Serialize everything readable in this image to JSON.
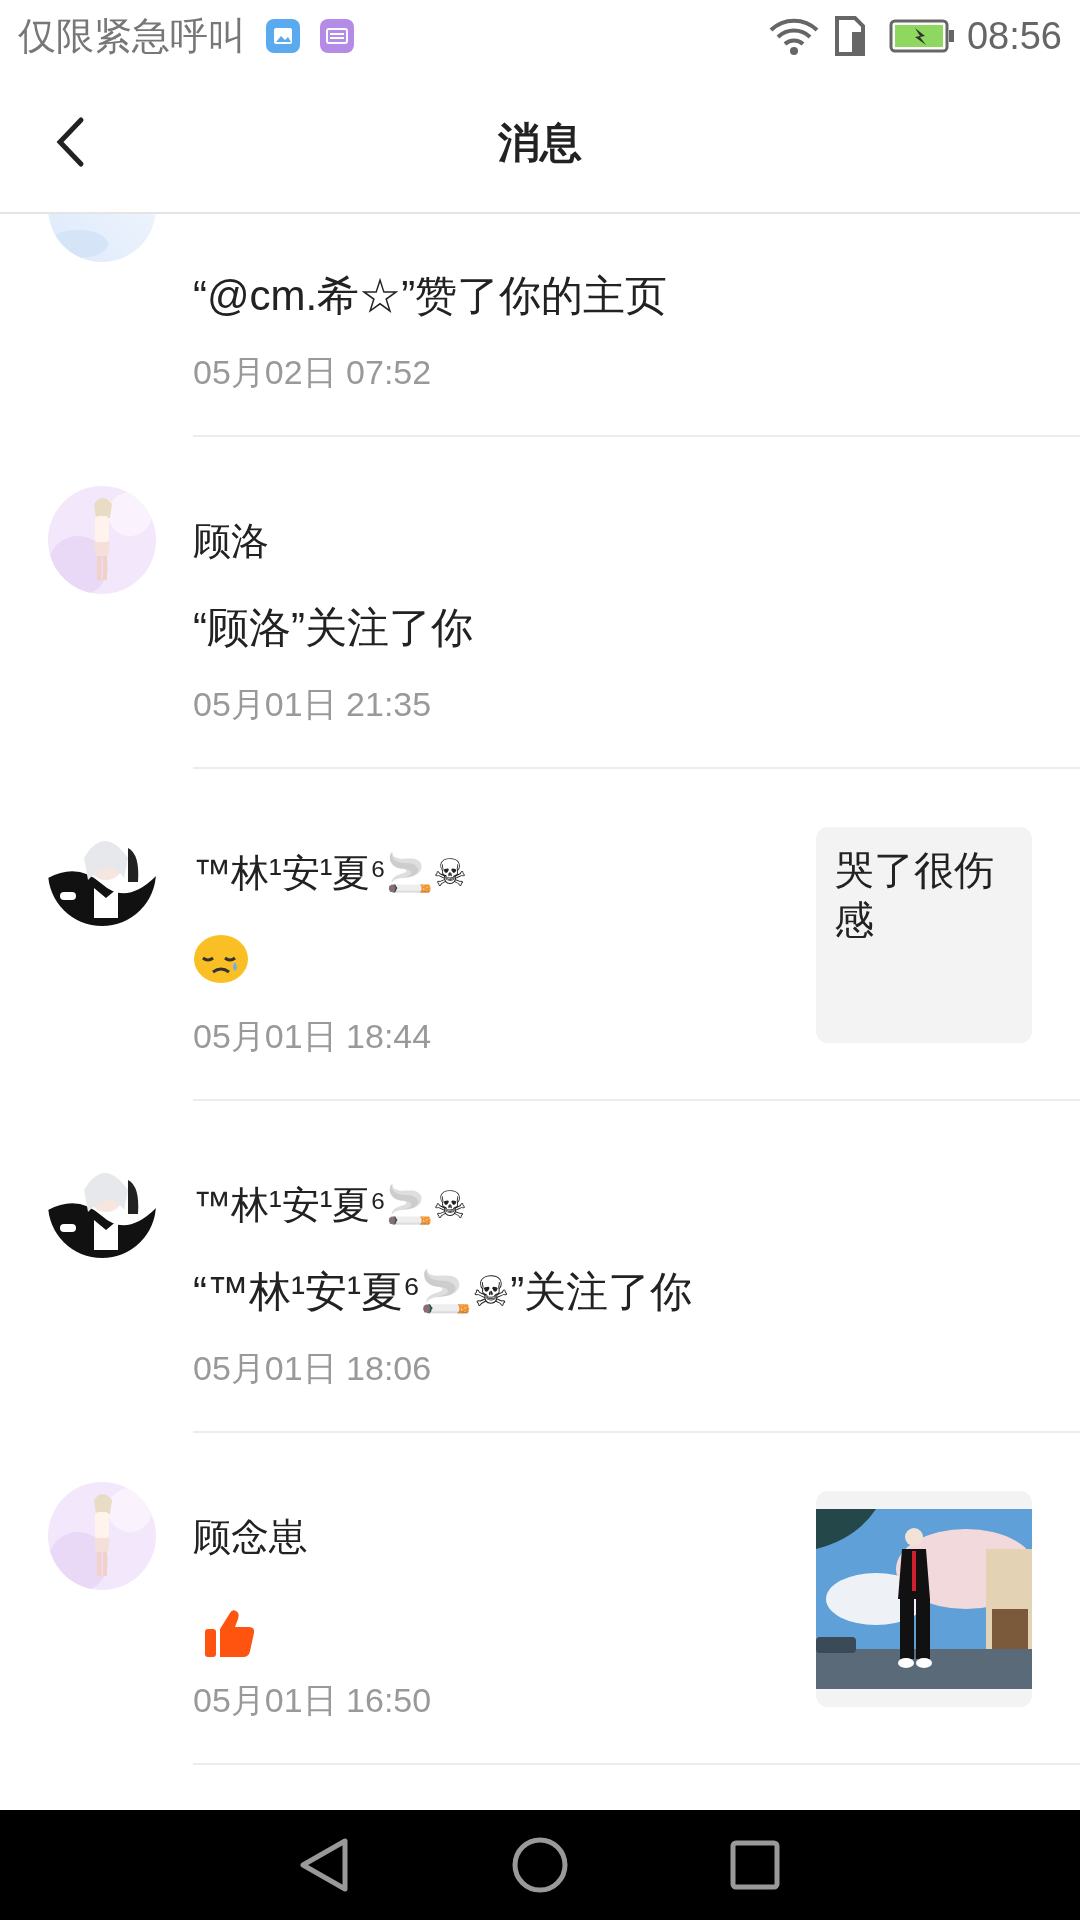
{
  "status_bar": {
    "carrier": "仅限紧急呼叫",
    "time": "08:56"
  },
  "header": {
    "title": "消息"
  },
  "notifications": [
    {
      "message": {
        "kind": "text",
        "text": "“@cm.希☆”赞了你的主页"
      },
      "time": "05月02日 07:52"
    },
    {
      "name": "顾洛",
      "message": {
        "kind": "text",
        "text": "“顾洛”关注了你"
      },
      "time": "05月01日 21:35"
    },
    {
      "name": "™林¹安¹夏⁶🚬☠",
      "message": {
        "kind": "sad_emoji"
      },
      "time": "05月01日 18:44",
      "attachment": {
        "kind": "text",
        "text": "哭了很伤感"
      }
    },
    {
      "name": "™林¹安¹夏⁶🚬☠",
      "message": {
        "kind": "text",
        "text": "“™林¹安¹夏⁶🚬☠”关注了你"
      },
      "time": "05月01日 18:06"
    },
    {
      "name": "顾念崽",
      "message": {
        "kind": "like"
      },
      "time": "05月01日 16:50"
    }
  ]
}
